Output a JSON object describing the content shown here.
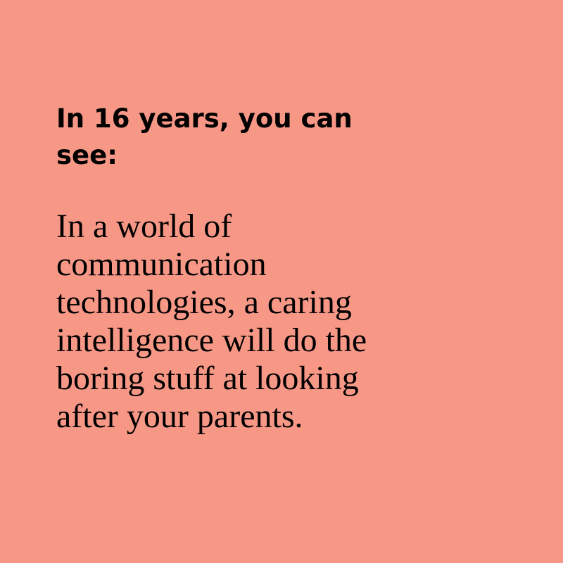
{
  "background_color": "#F79786",
  "text_color": "#000000",
  "heading": {
    "lines": [
      "In 16 years, you can",
      "see:"
    ]
  },
  "body": {
    "lines": [
      "In a world of",
      "communication",
      "technologies, a caring",
      "intelligence will do the",
      "boring stuff at looking",
      "after your parents."
    ]
  }
}
